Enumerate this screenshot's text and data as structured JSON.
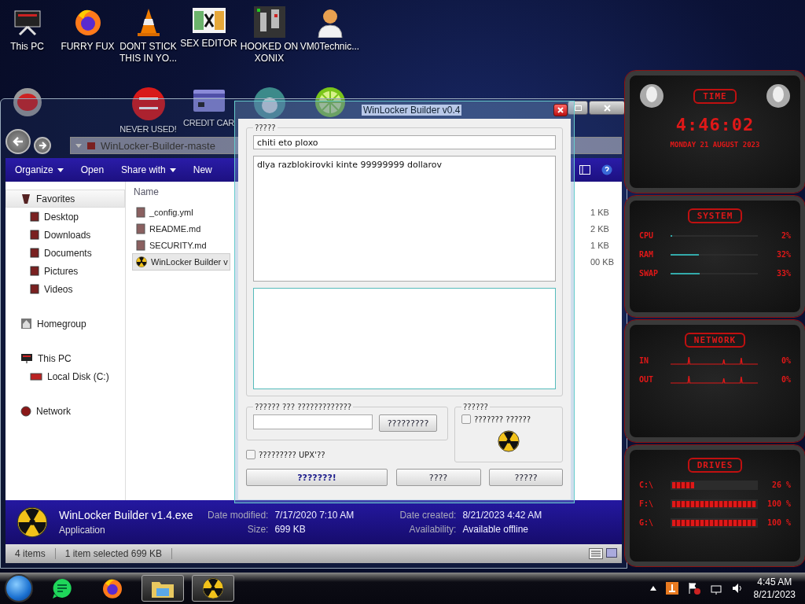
{
  "desktop": {
    "icons": [
      {
        "kind": "monitor",
        "label": "This PC"
      },
      {
        "kind": "browser",
        "label": "FURRY FUX"
      },
      {
        "kind": "cone",
        "label": "DONT STICK THIS IN YO..."
      },
      {
        "kind": "tiles",
        "label": "SEX EDITOR"
      },
      {
        "kind": "maze",
        "label": "HOOKED ON XONIX"
      },
      {
        "kind": "person",
        "label": "VM0Technic..."
      }
    ],
    "icons_row_2": [
      {
        "kind": "alien"
      },
      {
        "kind": "dev",
        "label": "NEVER USED!"
      },
      {
        "kind": "card",
        "label": "CREDIT CAR"
      },
      {
        "kind": "globe"
      },
      {
        "kind": "lime"
      }
    ]
  },
  "explorer": {
    "address": "WinLocker-Builder-maste",
    "toolbar": [
      {
        "label": "Organize",
        "menu": true
      },
      {
        "label": "Open",
        "menu": false
      },
      {
        "label": "Share with",
        "menu": true
      },
      {
        "label": "New",
        "menu": false
      }
    ],
    "nav": [
      {
        "label": "Favorites",
        "kind": "star",
        "selected": true,
        "children": [
          {
            "label": "Desktop",
            "kind": "folder",
            "selected": false
          },
          {
            "label": "Downloads",
            "kind": "folder",
            "selected": false
          },
          {
            "label": "Documents",
            "kind": "folder",
            "selected": false
          },
          {
            "label": "Pictures",
            "kind": "folder",
            "selected": false
          },
          {
            "label": "Videos",
            "kind": "folder",
            "selected": false
          }
        ]
      },
      {
        "label": "Homegroup",
        "kind": "home",
        "selected": false
      },
      {
        "label": "This PC",
        "kind": "monitor",
        "selected": false,
        "children": [
          {
            "label": "Local Disk (C:)",
            "kind": "disk",
            "selected": false
          }
        ]
      },
      {
        "label": "Network",
        "kind": "network",
        "selected": false
      }
    ],
    "column": "Name",
    "files": [
      {
        "name": "_config.yml",
        "size": "1 KB",
        "kind": "doc",
        "selected": false
      },
      {
        "name": "README.md",
        "size": "2 KB",
        "kind": "doc",
        "selected": false
      },
      {
        "name": "SECURITY.md",
        "size": "1 KB",
        "kind": "doc",
        "selected": false
      },
      {
        "name": "WinLocker Builder v",
        "size": "00 KB",
        "kind": "app",
        "selected": true
      }
    ],
    "details": {
      "name": "WinLocker Builder v1.4.exe",
      "type": "Application",
      "fields": [
        {
          "label": "Date modified:",
          "value": "7/17/2020 7:10 AM"
        },
        {
          "label": "Date created:",
          "value": "8/21/2023 4:42 AM"
        },
        {
          "label": "Size:",
          "value": "699 KB"
        },
        {
          "label": "Availability:",
          "value": "Available offline"
        }
      ]
    },
    "status": [
      "4 items",
      "1 item selected  699 KB"
    ]
  },
  "dialog": {
    "title": "WinLocker Builder v0.4",
    "main_group": "?????",
    "caption_value": "chiti eto ploxo",
    "message_value": "dlya razblokirovki kinte 99999999 dollarov",
    "unlock_group": "?????? ??? ?????????????",
    "unlock_button": "?????????",
    "upx": {
      "label": "????????? UPX'??",
      "checked": false
    },
    "icon_group": "??????",
    "icon_check": {
      "label": "??????? ??????",
      "checked": false
    },
    "buttons": [
      {
        "label": "???????!",
        "kind": "primary"
      },
      {
        "label": "????",
        "kind": "normal"
      },
      {
        "label": "?????",
        "kind": "normal"
      }
    ]
  },
  "gadget": {
    "time": {
      "title": "TIME",
      "clock": "4:46:02",
      "date": "MONDAY 21 AUGUST 2023"
    },
    "system": {
      "title": "SYSTEM",
      "rows": [
        {
          "label": "CPU",
          "reading": "2%",
          "level": 0.02
        },
        {
          "label": "RAM",
          "reading": "32%",
          "level": 0.32
        },
        {
          "label": "SWAP",
          "reading": "33%",
          "level": 0.33
        }
      ]
    },
    "network": {
      "title": "NETWORK",
      "rows": [
        {
          "label": "IN",
          "reading": "0%"
        },
        {
          "label": "OUT",
          "reading": "0%"
        }
      ]
    },
    "drives": {
      "title": "DRIVES",
      "rows": [
        {
          "label": "C:\\",
          "reading": "26 %",
          "level": 0.26
        },
        {
          "label": "F:\\",
          "reading": "100 %",
          "level": 1
        },
        {
          "label": "G:\\",
          "reading": "100 %",
          "level": 1
        }
      ]
    }
  },
  "taskbar": {
    "apps": [
      {
        "kind": "chat",
        "open": false
      },
      {
        "kind": "browser",
        "open": false
      },
      {
        "kind": "folder",
        "open": true
      },
      {
        "kind": "radiation",
        "open": true
      }
    ],
    "tray": {
      "time": "4:45 AM",
      "date": "8/21/2023"
    }
  }
}
